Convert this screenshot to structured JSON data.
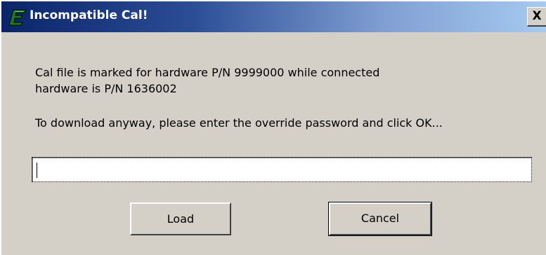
{
  "window": {
    "title": "Incompatible Cal!",
    "icon": "app-logo-icon",
    "close_label": "X"
  },
  "message": {
    "line1": "Cal file is marked for hardware P/N 9999000 while connected",
    "line2": "hardware is P/N 1636002",
    "instruction": "To download anyway, please enter the override password and click OK..."
  },
  "password_field": {
    "value": ""
  },
  "buttons": {
    "load_label": "Load",
    "cancel_label": "Cancel"
  },
  "colors": {
    "titlebar_start": "#0a246a",
    "titlebar_end": "#a6caf0",
    "dialog_face": "#d4d0c8",
    "icon_green": "#2db82d"
  }
}
